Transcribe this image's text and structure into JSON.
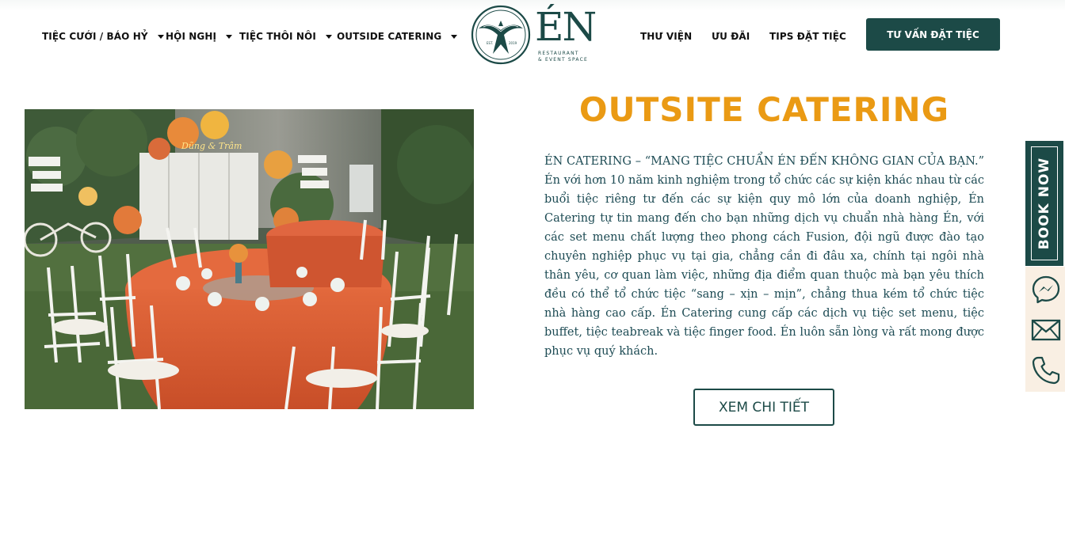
{
  "nav": {
    "left": [
      {
        "label": "TIỆC CƯỚI / BÁO HỶ"
      },
      {
        "label": "HỘI NGHỊ"
      },
      {
        "label": "TIỆC THÔI NÔI"
      },
      {
        "label": "OUTSIDE CATERING"
      }
    ],
    "right": [
      {
        "label": "THƯ VIỆN"
      },
      {
        "label": "ƯU ĐÃI"
      },
      {
        "label": "TIPS ĐẶT TIỆC"
      }
    ],
    "cta_label": "TƯ VẤN ĐẶT TIỆC"
  },
  "logo": {
    "word": "ÉN",
    "subtitle_line1": "RESTAURANT",
    "subtitle_line2": "& EVENT SPACE",
    "est": "EST.",
    "year": "2019",
    "icon": "swallow-bird-emblem"
  },
  "main": {
    "title": "OUTSITE CATERING",
    "description": "ÉN CATERING – “MANG TIỆC CHUẨN ÉN ĐẾN KHÔNG GIAN CỦA BẠN.” Én với hơn 10 năm kinh nghiệm trong tổ chức các sự kiện khác nhau từ các buổi tiệc riêng tư đến các sự kiện quy mô lớn của doanh nghiệp, Én Catering tự tin mang đến cho bạn những dịch vụ chuẩn nhà hàng Én, với các set menu chất lượng theo phong cách Fusion, đội ngũ được đào tạo chuyên nghiệp phục vụ tại gia, chẳng cần đi đâu xa, chính tại ngôi nhà thân yêu, cơ quan làm việc, những địa điểm quan thuộc mà bạn yêu thích đều có thể tổ chức tiệc “sang – xịn – mịn”, chẳng thua kém tổ chức tiệc nhà hàng cao cấp. Én Catering cung cấp các dịch vụ tiệc set menu, tiệc buffet, tiệc teabreak và tiệc finger food. Én luôn sẵn lòng và rất mong được phục vụ quý khách.",
    "more_label": "XEM CHI TIẾT",
    "photo_sign": "Dũng & Trâm"
  },
  "sidebar": {
    "book_label": "BOOK NOW",
    "icons": [
      "messenger-icon",
      "mail-icon",
      "phone-icon"
    ]
  },
  "colors": {
    "brand": "#1c4a47",
    "accent": "#ea9a14",
    "text": "#1d4b54",
    "sidebar_bg": "#f9efe3"
  }
}
